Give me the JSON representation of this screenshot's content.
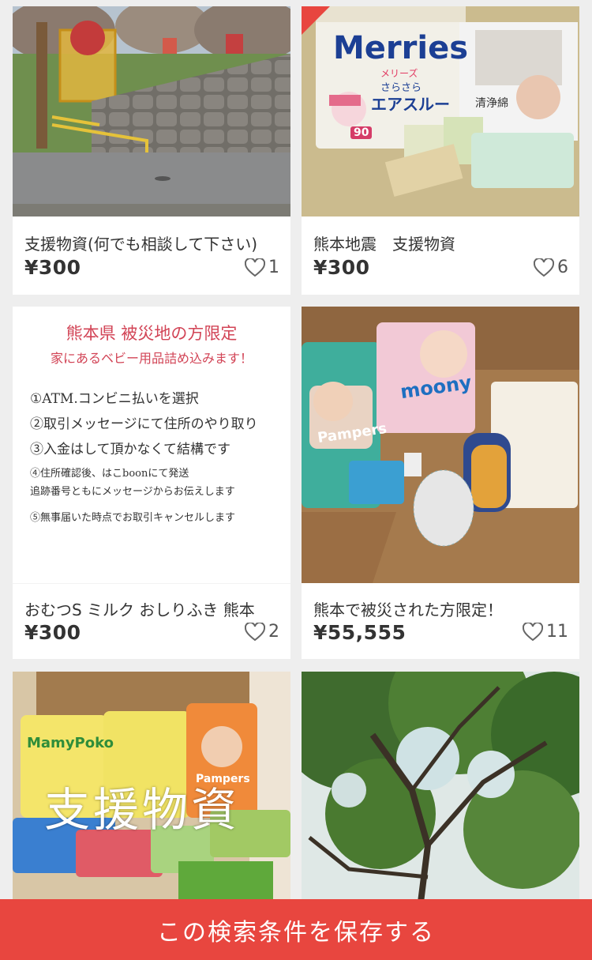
{
  "items": [
    {
      "title": "支援物資(何でも相談して下さい)",
      "price": "¥300",
      "likes": "1"
    },
    {
      "title": "熊本地震　支援物資",
      "price": "¥300",
      "likes": "6"
    },
    {
      "title": "おむつS ミルク おしりふき 熊本",
      "price": "¥300",
      "likes": "2"
    },
    {
      "title": "熊本で被災された方限定！",
      "price": "¥55,555",
      "likes": "11"
    }
  ],
  "item2_image": {
    "brand": "Merries",
    "brand_sub": "メリーズ",
    "line": "エアスルー",
    "tagline": "さらさら",
    "size_badge": "90",
    "wipes_label": "清浄綿"
  },
  "item3_image": {
    "heading": "熊本県 被災地の方限定",
    "subheading": "家にあるベビー用品詰め込みます！",
    "steps": [
      "①ATM.コンビニ払いを選択",
      "②取引メッセージにて住所のやり取り",
      "③入金はして頂かなくて結構です",
      "④住所確認後、はこboonにて発送",
      "追跡番号ともにメッセージからお伝えします",
      "⑤無事届いた時点でお取引キャンセルします"
    ]
  },
  "item4_image": {
    "brand_a": "Pampers",
    "brand_b": "moony"
  },
  "item5_image": {
    "brand_a": "MamyPoko",
    "brand_b": "Pampers",
    "overlay": "支援物資"
  },
  "save_search_label": "この検索条件を保存する",
  "colors": {
    "accent": "#e8463f",
    "card_bg": "#ffffff",
    "page_bg": "#eeeeee"
  }
}
